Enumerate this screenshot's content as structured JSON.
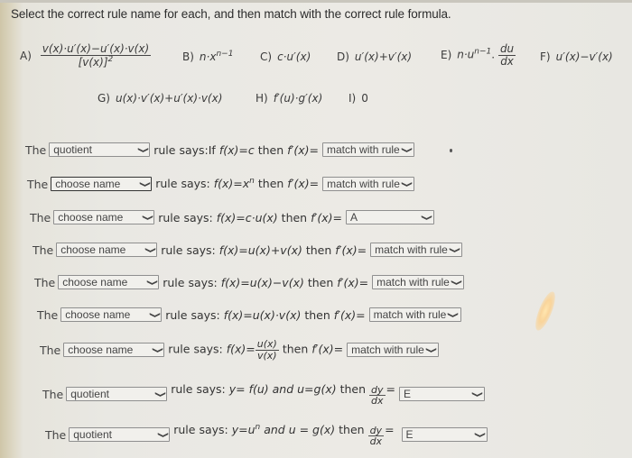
{
  "instructions": "Select the correct rule name for each, and then match with the correct rule formula.",
  "options": [
    {
      "label": "A)",
      "numerator": "v(x)·u′(x)−u′(x)·v(x)",
      "denominator": "[v(x)]",
      "den_sup": "2"
    },
    {
      "label": "B)",
      "text": "n·x",
      "sup": "n−1"
    },
    {
      "label": "C)",
      "text": "c·u′(x)"
    },
    {
      "label": "D)",
      "text": "u′(x)+v′(x)"
    },
    {
      "label": "E)",
      "text": "n·u",
      "sup": "n−1",
      "suffix": ".",
      "frac_num": "du",
      "frac_den": "dx"
    },
    {
      "label": "F)",
      "text": "u′(x)−v′(x)"
    },
    {
      "label": "G)",
      "text": "u(x)·v′(x)+u′(x)·v(x)"
    },
    {
      "label": "H)",
      "text": "f′(u)·g′(x)"
    },
    {
      "label": "I)",
      "text": "0"
    }
  ],
  "rows": [
    {
      "the": "The",
      "name_value": "quotient",
      "says": "rule says:If",
      "f": "f(x)=c",
      "then": "then",
      "fprime": "f′(x)=",
      "rule_value": "match with rule"
    },
    {
      "the": "The",
      "name_value": "choose name",
      "says": "rule says:",
      "f": "f(x)=x",
      "f_sup": "n",
      "then": "then",
      "fprime": "f′(x)=",
      "rule_value": "match with rule"
    },
    {
      "the": "The",
      "name_value": "choose name",
      "says": "rule says:",
      "f": "f(x)=c·u(x)",
      "then": "then",
      "fprime": "f′(x)=",
      "rule_value": "A"
    },
    {
      "the": "The",
      "name_value": "choose name",
      "says": "rule says:",
      "f": "f(x)=u(x)+v(x)",
      "then": "then",
      "fprime": "f′(x)=",
      "rule_value": "match with rule"
    },
    {
      "the": "The",
      "name_value": "choose name",
      "says": "rule says:",
      "f": "f(x)=u(x)−v(x)",
      "then": "then",
      "fprime": "f′(x)=",
      "rule_value": "match with rule"
    },
    {
      "the": "The",
      "name_value": "choose name",
      "says": "rule says:",
      "f": "f(x)=u(x)·v(x)",
      "then": "then",
      "fprime": "f′(x)=",
      "rule_value": "match with rule"
    },
    {
      "the": "The",
      "name_value": "choose name",
      "says": "rule says:",
      "f": "f(x)=",
      "f_num": "u(x)",
      "f_den": "v(x)",
      "then": "then",
      "fprime": "f′(x)=",
      "rule_value": "match with rule"
    },
    {
      "the": "The",
      "name_value": "quotient",
      "says": "rule says:",
      "f": "y= f(u) and u=g(x)",
      "then": "then",
      "dy": "dy",
      "dx": "dx",
      "eq": "=",
      "rule_value": "E"
    },
    {
      "the": "The",
      "name_value": "quotient",
      "says": "rule says:",
      "f": "y=u",
      "f_sup": "n",
      "f_tail": " and u = g(x)",
      "then": "then",
      "dy": "dy",
      "dx": "dx",
      "eq": "=",
      "rule_value": "E"
    }
  ]
}
